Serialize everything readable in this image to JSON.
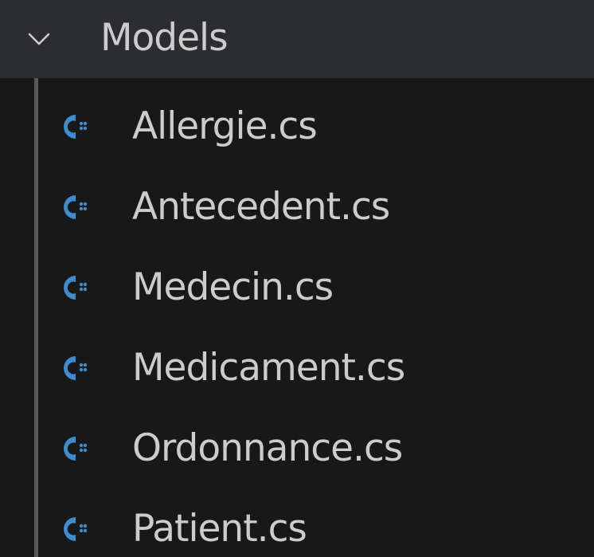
{
  "colors": {
    "background": "#181818",
    "folder_row_background": "#2b2d30",
    "text": "#cccccc",
    "csharp_icon": "#3d8ccf",
    "indent_guide": "#585858"
  },
  "folder": {
    "label": "Models",
    "expanded": true,
    "chevron_icon": "chevron-down-icon"
  },
  "files": [
    {
      "label": "Allergie.cs",
      "icon": "csharp-file-icon"
    },
    {
      "label": "Antecedent.cs",
      "icon": "csharp-file-icon"
    },
    {
      "label": "Medecin.cs",
      "icon": "csharp-file-icon"
    },
    {
      "label": "Medicament.cs",
      "icon": "csharp-file-icon"
    },
    {
      "label": "Ordonnance.cs",
      "icon": "csharp-file-icon"
    },
    {
      "label": "Patient.cs",
      "icon": "csharp-file-icon"
    }
  ]
}
